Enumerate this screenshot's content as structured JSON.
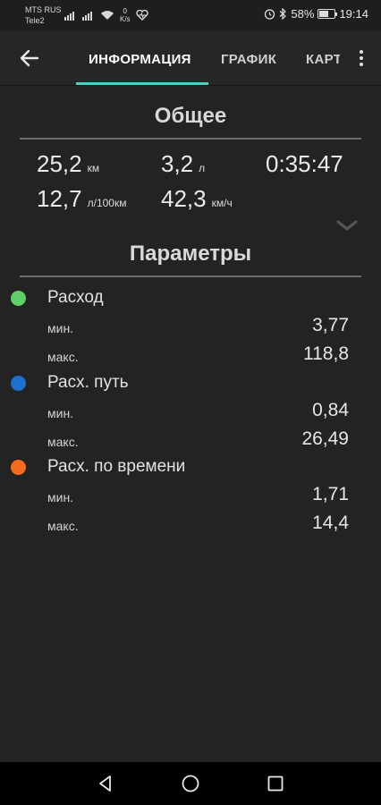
{
  "status_bar": {
    "carrier_1": "MTS RUS",
    "carrier_2": "Tele2",
    "net_speed": "0",
    "net_unit": "K/s",
    "battery": "58%",
    "battery_level": 0.58,
    "time": "19:14"
  },
  "tabs": [
    {
      "label": "ИНФОРМАЦИЯ",
      "active": true
    },
    {
      "label": "ГРАФИК",
      "active": false
    },
    {
      "label": "КАРТА",
      "active": false
    }
  ],
  "accent_color": "#4dd0c1",
  "summary": {
    "title": "Общее",
    "distance": {
      "value": "25,2",
      "unit": "км"
    },
    "fuel": {
      "value": "3,2",
      "unit": "л"
    },
    "duration": {
      "value": "0:35:47"
    },
    "consumption": {
      "value": "12,7",
      "unit": "л/100км"
    },
    "speed": {
      "value": "42,3",
      "unit": "км/ч"
    }
  },
  "parameters": {
    "title": "Параметры",
    "min_label": "мин.",
    "max_label": "макс.",
    "items": [
      {
        "name": "Расход",
        "color": "#5fd068",
        "min": "3,77",
        "max": "118,8"
      },
      {
        "name": "Расх. путь",
        "color": "#1f6fd0",
        "min": "0,84",
        "max": "26,49"
      },
      {
        "name": "Расх. по времени",
        "color": "#f46a1f",
        "min": "1,71",
        "max": "14,4"
      }
    ]
  }
}
